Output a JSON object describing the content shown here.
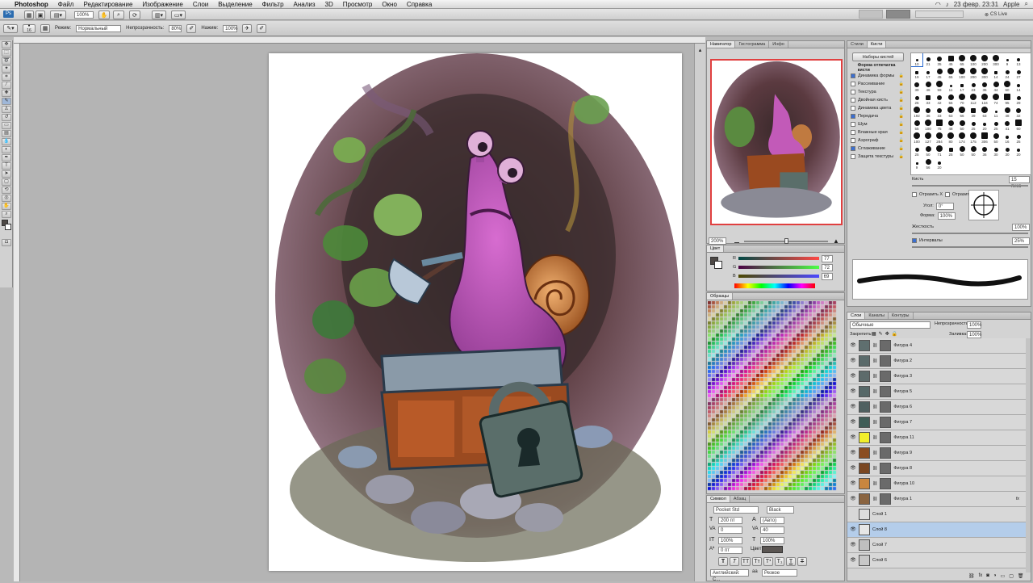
{
  "menubar": {
    "apple_symbol": "",
    "app_name": "Photoshop",
    "items": [
      "Файл",
      "Редактирование",
      "Изображение",
      "Слои",
      "Выделение",
      "Фильтр",
      "Анализ",
      "3D",
      "Просмотр",
      "Окно",
      "Справка"
    ],
    "datetime": "23 февр. 23:31",
    "user": "Apple"
  },
  "appbar": {
    "zoom": "100%",
    "cs_live": "CS Live"
  },
  "options": {
    "brush_size": "16",
    "mode_label": "Режим:",
    "mode_value": "Нормальный",
    "opacity_label": "Непрозрачность:",
    "opacity_value": "80%",
    "flow_label": "Нажим:",
    "flow_value": "100%"
  },
  "navigator": {
    "tabs": [
      "Навигатор",
      "Гистограмма",
      "Инфо"
    ],
    "zoom": "200%"
  },
  "brush_panel": {
    "tabs": [
      "Стили",
      "Кисти"
    ],
    "presets_button": "Наборы кистей",
    "options": [
      {
        "label": "Форма отпечатка кисти",
        "on": false
      },
      {
        "label": "Динамика формы",
        "on": true
      },
      {
        "label": "Рассеивание",
        "on": false
      },
      {
        "label": "Текстура",
        "on": false
      },
      {
        "label": "Двойная кисть",
        "on": false
      },
      {
        "label": "Динамика цвета",
        "on": false
      },
      {
        "label": "Передача",
        "on": true
      },
      {
        "label": "Шум",
        "on": false
      },
      {
        "label": "Влажные края",
        "on": false
      },
      {
        "label": "Аэрограф",
        "on": false
      },
      {
        "label": "Сглаживание",
        "on": true
      },
      {
        "label": "Защита текстуры",
        "on": false
      }
    ],
    "tip_sizes": [
      "10",
      "21",
      "35",
      "45",
      "65",
      "100",
      "200",
      "300",
      "9",
      "13",
      "19",
      "17",
      "45",
      "65",
      "100",
      "200",
      "300",
      "14",
      "24",
      "27",
      "39",
      "46",
      "59",
      "11",
      "17",
      "23",
      "36",
      "44",
      "60",
      "14",
      "26",
      "33",
      "42",
      "55",
      "70",
      "112",
      "134",
      "74",
      "95",
      "29",
      "192",
      "36",
      "33",
      "63",
      "66",
      "39",
      "63",
      "11",
      "48",
      "32",
      "55",
      "100",
      "75",
      "48",
      "50",
      "25",
      "20",
      "25",
      "41",
      "60",
      "100",
      "127",
      "284",
      "80",
      "174",
      "175",
      "306",
      "50",
      "16",
      "25",
      "25",
      "50",
      "71",
      "25",
      "50",
      "50",
      "36",
      "30",
      "30",
      "20",
      "9",
      "56",
      "20"
    ],
    "size_label": "Кисть",
    "size_value": "15 пикс",
    "flip_x": "Отразить X",
    "flip_y": "Отразить Y",
    "angle_label": "Угол:",
    "angle_value": "0°",
    "roundness_label": "Форма:",
    "roundness_value": "100%",
    "hardness_label": "Жесткость",
    "hardness_value": "100%",
    "spacing_label": "Интервалы",
    "spacing_value": "25%"
  },
  "color_panel": {
    "tabs": [
      "Цвет"
    ],
    "r": "77",
    "g": "72",
    "b": "69",
    "labels": [
      "R",
      "G",
      "B"
    ]
  },
  "swatches_panel": {
    "tabs": [
      "Образцы"
    ]
  },
  "char_panel": {
    "tabs": [
      "Символ",
      "Абзац"
    ],
    "font": "Pocket Std",
    "style": "Black",
    "size": "200 пт",
    "leading": "(Авто)",
    "tracking": "0",
    "kerning": "40",
    "vscale": "100%",
    "hscale": "100%",
    "baseline": "0 пт",
    "color_label": "Цвет:",
    "lang": "Английский: С...",
    "aa": "Резкое"
  },
  "layers_panel": {
    "tabs": [
      "Слои",
      "Каналы",
      "Контуры"
    ],
    "blend": "Обычные",
    "opacity_label": "Непрозрачность:",
    "opacity_value": "100%",
    "lock_label": "Закрепить:",
    "fill_label": "Заливка:",
    "fill_value": "100%",
    "layers": [
      {
        "name": "Фигура 4",
        "color": "#5f6f6f",
        "sel": false
      },
      {
        "name": "Фигура 2",
        "color": "#5a6a6a",
        "sel": false
      },
      {
        "name": "Фигура 3",
        "color": "#5d6b6b",
        "sel": false
      },
      {
        "name": "Фигура 5",
        "color": "#566868",
        "sel": false
      },
      {
        "name": "Фигура 6",
        "color": "#4f6060",
        "sel": false
      },
      {
        "name": "Фигура 7",
        "color": "#3f5d57",
        "sel": false
      },
      {
        "name": "Фигура 11",
        "color": "#f2ef2a",
        "sel": false
      },
      {
        "name": "Фигура 9",
        "color": "#8a4d21",
        "sel": false
      },
      {
        "name": "Фигура 8",
        "color": "#7a4722",
        "sel": false
      },
      {
        "name": "Фигура 10",
        "color": "#c9863f",
        "sel": false
      },
      {
        "name": "Фигура 1",
        "color": "#8a6440",
        "sel": false
      },
      {
        "name": "Слой 1",
        "color": "#dcdcdc",
        "sel": false
      },
      {
        "name": "Слой 8",
        "color": "#e6e6e6",
        "sel": true
      },
      {
        "name": "Слой 7",
        "color": "#bfbfbf",
        "sel": false
      },
      {
        "name": "Слой 6",
        "color": "#c8c8c8",
        "sel": false
      }
    ]
  }
}
